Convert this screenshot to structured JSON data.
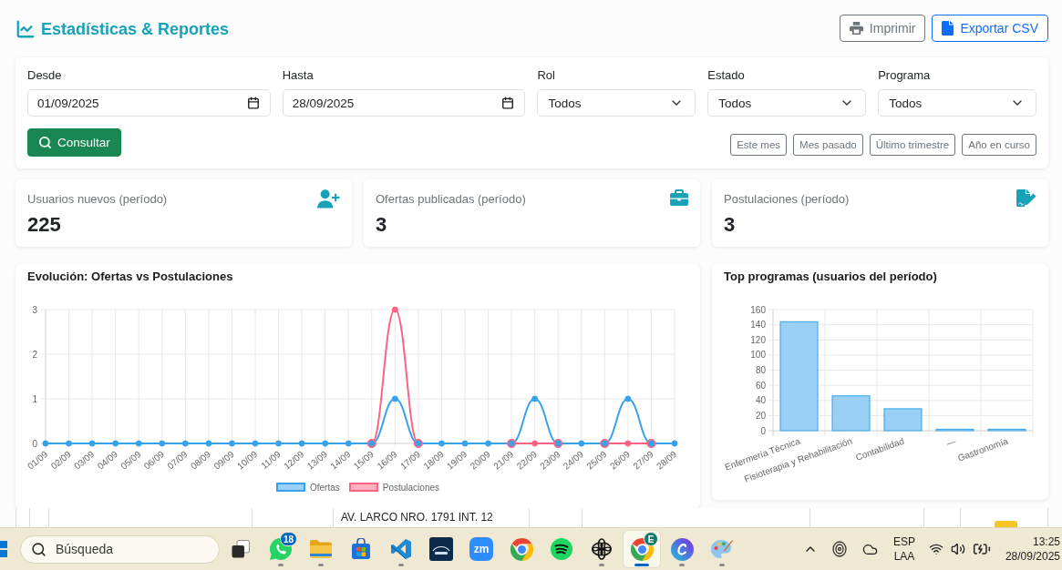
{
  "header": {
    "title": "Estadísticas & Reportes",
    "buttons": [
      {
        "kind": "print",
        "label": "Imprimir"
      },
      {
        "kind": "export",
        "label": "Exportar CSV"
      }
    ]
  },
  "filters": {
    "fields": [
      {
        "kind": "date",
        "label": "Desde",
        "value": "01/09/2025"
      },
      {
        "kind": "date",
        "label": "Hasta",
        "value": "28/09/2025"
      },
      {
        "kind": "select",
        "label": "Rol",
        "value": "Todos"
      },
      {
        "kind": "select",
        "label": "Estado",
        "value": "Todos"
      },
      {
        "kind": "select",
        "label": "Programa",
        "value": "Todos"
      }
    ],
    "submit": "Consultar",
    "quick_ranges": [
      "Este mes",
      "Mes pasado",
      "Último trimestre",
      "Año en curso"
    ]
  },
  "stats": [
    {
      "kind": "user_add",
      "label": "Usuarios nuevos (período)",
      "value": "225"
    },
    {
      "kind": "briefcase",
      "label": "Ofertas publicadas (período)",
      "value": "3"
    },
    {
      "kind": "document_sign",
      "label": "Postulaciones (período)",
      "value": "3"
    }
  ],
  "evolution_chart": {
    "title": "Evolución: Ofertas vs Postulaciones",
    "chart_data": {
      "type": "line",
      "categories": [
        "01/09",
        "02/09",
        "03/09",
        "04/09",
        "05/09",
        "06/09",
        "07/09",
        "08/09",
        "09/09",
        "10/09",
        "11/09",
        "12/09",
        "13/09",
        "14/09",
        "15/09",
        "16/09",
        "17/09",
        "18/09",
        "19/09",
        "20/09",
        "21/09",
        "22/09",
        "23/09",
        "24/09",
        "25/09",
        "26/09",
        "27/09",
        "28/09"
      ],
      "series": [
        {
          "name": "Ofertas",
          "color": "#36a2eb",
          "marker": "circle",
          "values": [
            0,
            0,
            0,
            0,
            0,
            0,
            0,
            0,
            0,
            0,
            0,
            0,
            0,
            0,
            0,
            1,
            0,
            0,
            0,
            0,
            0,
            1,
            0,
            0,
            0,
            1,
            0,
            0
          ]
        },
        {
          "name": "Postulaciones",
          "color": "#ff6384",
          "marker": "circle",
          "values": [
            null,
            null,
            null,
            null,
            null,
            null,
            null,
            null,
            null,
            null,
            null,
            null,
            null,
            null,
            0,
            3,
            0,
            null,
            null,
            null,
            0,
            0,
            0,
            null,
            0,
            0,
            0,
            null
          ]
        }
      ],
      "ylim": [
        0,
        3
      ],
      "yticks": [
        0,
        1,
        2,
        3
      ],
      "grid": true,
      "legend": "bottom"
    }
  },
  "programs_chart": {
    "title": "Top programas (usuarios del período)",
    "chart_data": {
      "type": "bar",
      "categories": [
        "Enfermería Técnica",
        "Fisioterapia y Rehabilitación",
        "Contabilidad",
        "—",
        "Gastronomía"
      ],
      "values": [
        144,
        46,
        29,
        2,
        2
      ],
      "ylim": [
        0,
        160
      ],
      "yticks": [
        0,
        20,
        40,
        60,
        80,
        100,
        120,
        140,
        160
      ],
      "grid": true
    }
  },
  "partial_row": {
    "text": "AV. LARCO NRO. 1791 INT. 12"
  },
  "taskbar": {
    "search": {
      "placeholder": "Búsqueda"
    },
    "apps": [
      {
        "kind": "window_stack",
        "running": false,
        "selected": false
      },
      {
        "kind": "chat",
        "badge": "18",
        "running": true,
        "selected": false
      },
      {
        "kind": "folder",
        "running": true,
        "selected": false
      },
      {
        "kind": "store",
        "running": false,
        "selected": false
      },
      {
        "kind": "code",
        "running": true,
        "selected": false
      },
      {
        "kind": "dark_tile",
        "running": false,
        "selected": false
      },
      {
        "kind": "text_tile",
        "label": "zm",
        "running": false,
        "selected": false
      },
      {
        "kind": "browser",
        "running": false,
        "selected": false
      },
      {
        "kind": "waves",
        "running": false,
        "selected": false
      },
      {
        "kind": "knot",
        "running": true,
        "selected": false
      },
      {
        "kind": "browser",
        "badge": "E",
        "running": true,
        "selected": true
      },
      {
        "kind": "crescent",
        "running": true,
        "selected": false
      },
      {
        "kind": "palette",
        "running": true,
        "selected": false
      }
    ],
    "tray": {
      "language": "ESP",
      "layout": "LAA",
      "time": "13:25",
      "date": "28/09/2025"
    }
  }
}
